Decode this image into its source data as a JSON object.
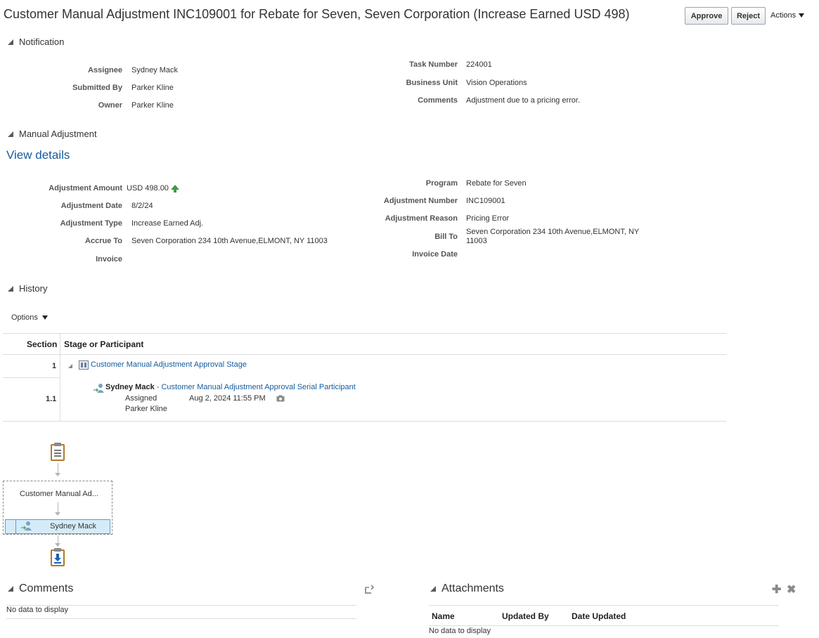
{
  "header": {
    "title": "Customer Manual Adjustment INC109001 for Rebate for Seven, Seven Corporation (Increase Earned USD 498)",
    "approve_label": "Approve",
    "reject_label": "Reject",
    "actions_label": "Actions"
  },
  "notification": {
    "heading": "Notification",
    "left": [
      {
        "label": "Assignee",
        "value": "Sydney Mack"
      },
      {
        "label": "Submitted By",
        "value": "Parker Kline"
      },
      {
        "label": "Owner",
        "value": "Parker Kline"
      }
    ],
    "right": [
      {
        "label": "Task Number",
        "value": "224001"
      },
      {
        "label": "Business Unit",
        "value": "Vision Operations"
      },
      {
        "label": "Comments",
        "value": "Adjustment due to a pricing error."
      }
    ]
  },
  "manual_adjustment": {
    "heading": "Manual Adjustment",
    "view_details": "View details",
    "left": [
      {
        "label": "Adjustment Amount",
        "value": "USD 498.00"
      },
      {
        "label": "Adjustment Date",
        "value": "8/2/24"
      },
      {
        "label": "Adjustment Type",
        "value": "Increase Earned Adj."
      },
      {
        "label": "Accrue To",
        "value": "Seven Corporation 234 10th Avenue,ELMONT, NY 11003"
      },
      {
        "label": "Invoice",
        "value": ""
      }
    ],
    "right": [
      {
        "label": "Program",
        "value": "Rebate for Seven"
      },
      {
        "label": "Adjustment Number",
        "value": "INC109001"
      },
      {
        "label": "Adjustment Reason",
        "value": "Pricing Error"
      },
      {
        "label": "Bill To",
        "value_line1": "Seven Corporation 234 10th Avenue,ELMONT, NY",
        "value_line2": "11003"
      },
      {
        "label": "Invoice Date",
        "value": ""
      }
    ]
  },
  "history": {
    "heading": "History",
    "options_label": "Options",
    "columns": [
      "Section",
      "Stage or Participant"
    ],
    "rows": [
      {
        "section": "1",
        "stage": "Customer Manual Adjustment Approval Stage"
      },
      {
        "section": "1.1",
        "participant": "Sydney Mack",
        "separator": " - ",
        "participant_role": "Customer Manual Adjustment Approval Serial Participant",
        "status": "Assigned",
        "date": "Aug 2, 2024 11:55 PM",
        "by": "Parker Kline"
      }
    ]
  },
  "flow": {
    "stage_label": "Customer Manual Ad...",
    "participant_label": "Sydney Mack"
  },
  "comments": {
    "heading": "Comments",
    "empty": "No data to display"
  },
  "attachments": {
    "heading": "Attachments",
    "columns": [
      "Name",
      "Updated By",
      "Date Updated"
    ],
    "empty": "No data to display"
  },
  "colors": {
    "link": "#145c9e",
    "up_arrow": "#3f9a3f",
    "selected_participant": "#d6ebf8",
    "clipboard_border": "#b07a2a"
  },
  "icons": [
    "disclosure-triangle-icon",
    "up-arrow-icon",
    "stage-icon",
    "participant-icon",
    "camera-icon",
    "clipboard-start-icon",
    "clipboard-end-icon",
    "add-icon",
    "delete-icon",
    "reply-icon"
  ]
}
